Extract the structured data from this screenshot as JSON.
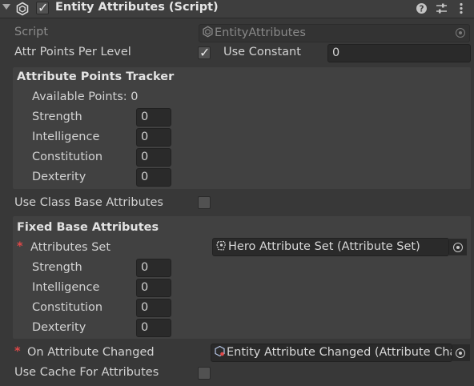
{
  "component": {
    "title": "Entity Attributes (Script)",
    "enabled": true,
    "header_icons": [
      "help-icon",
      "presets-icon",
      "more-menu-icon"
    ]
  },
  "script_row": {
    "label": "Script",
    "value": "EntityAttributes"
  },
  "attr_points_per_level": {
    "label": "Attr Points Per Level",
    "use_constant_checked": true,
    "use_constant_label": "Use Constant",
    "value": "0"
  },
  "attribute_points_tracker": {
    "heading": "Attribute Points Tracker",
    "available_points": "Available Points: 0",
    "rows": [
      {
        "label": "Strength",
        "value": "0"
      },
      {
        "label": "Intelligence",
        "value": "0"
      },
      {
        "label": "Constitution",
        "value": "0"
      },
      {
        "label": "Dexterity",
        "value": "0"
      }
    ]
  },
  "use_class_base_attributes": {
    "label": "Use Class Base Attributes",
    "checked": false
  },
  "fixed_base_attributes": {
    "heading": "Fixed Base Attributes",
    "attributes_set": {
      "required_marker": "*",
      "label": "Attributes Set",
      "value": "Hero Attribute Set (Attribute Set)"
    },
    "rows": [
      {
        "label": "Strength",
        "value": "0"
      },
      {
        "label": "Intelligence",
        "value": "0"
      },
      {
        "label": "Constitution",
        "value": "0"
      },
      {
        "label": "Dexterity",
        "value": "0"
      }
    ]
  },
  "on_attribute_changed": {
    "required_marker": "*",
    "label": "On Attribute Changed",
    "value": "Entity Attribute Changed (Attribute Cha"
  },
  "use_cache_for_attributes": {
    "label": "Use Cache For Attributes",
    "checked": false
  },
  "colors": {
    "background": "#383838",
    "group": "#414141",
    "field": "#2a2a2a",
    "required": "#e04848"
  }
}
